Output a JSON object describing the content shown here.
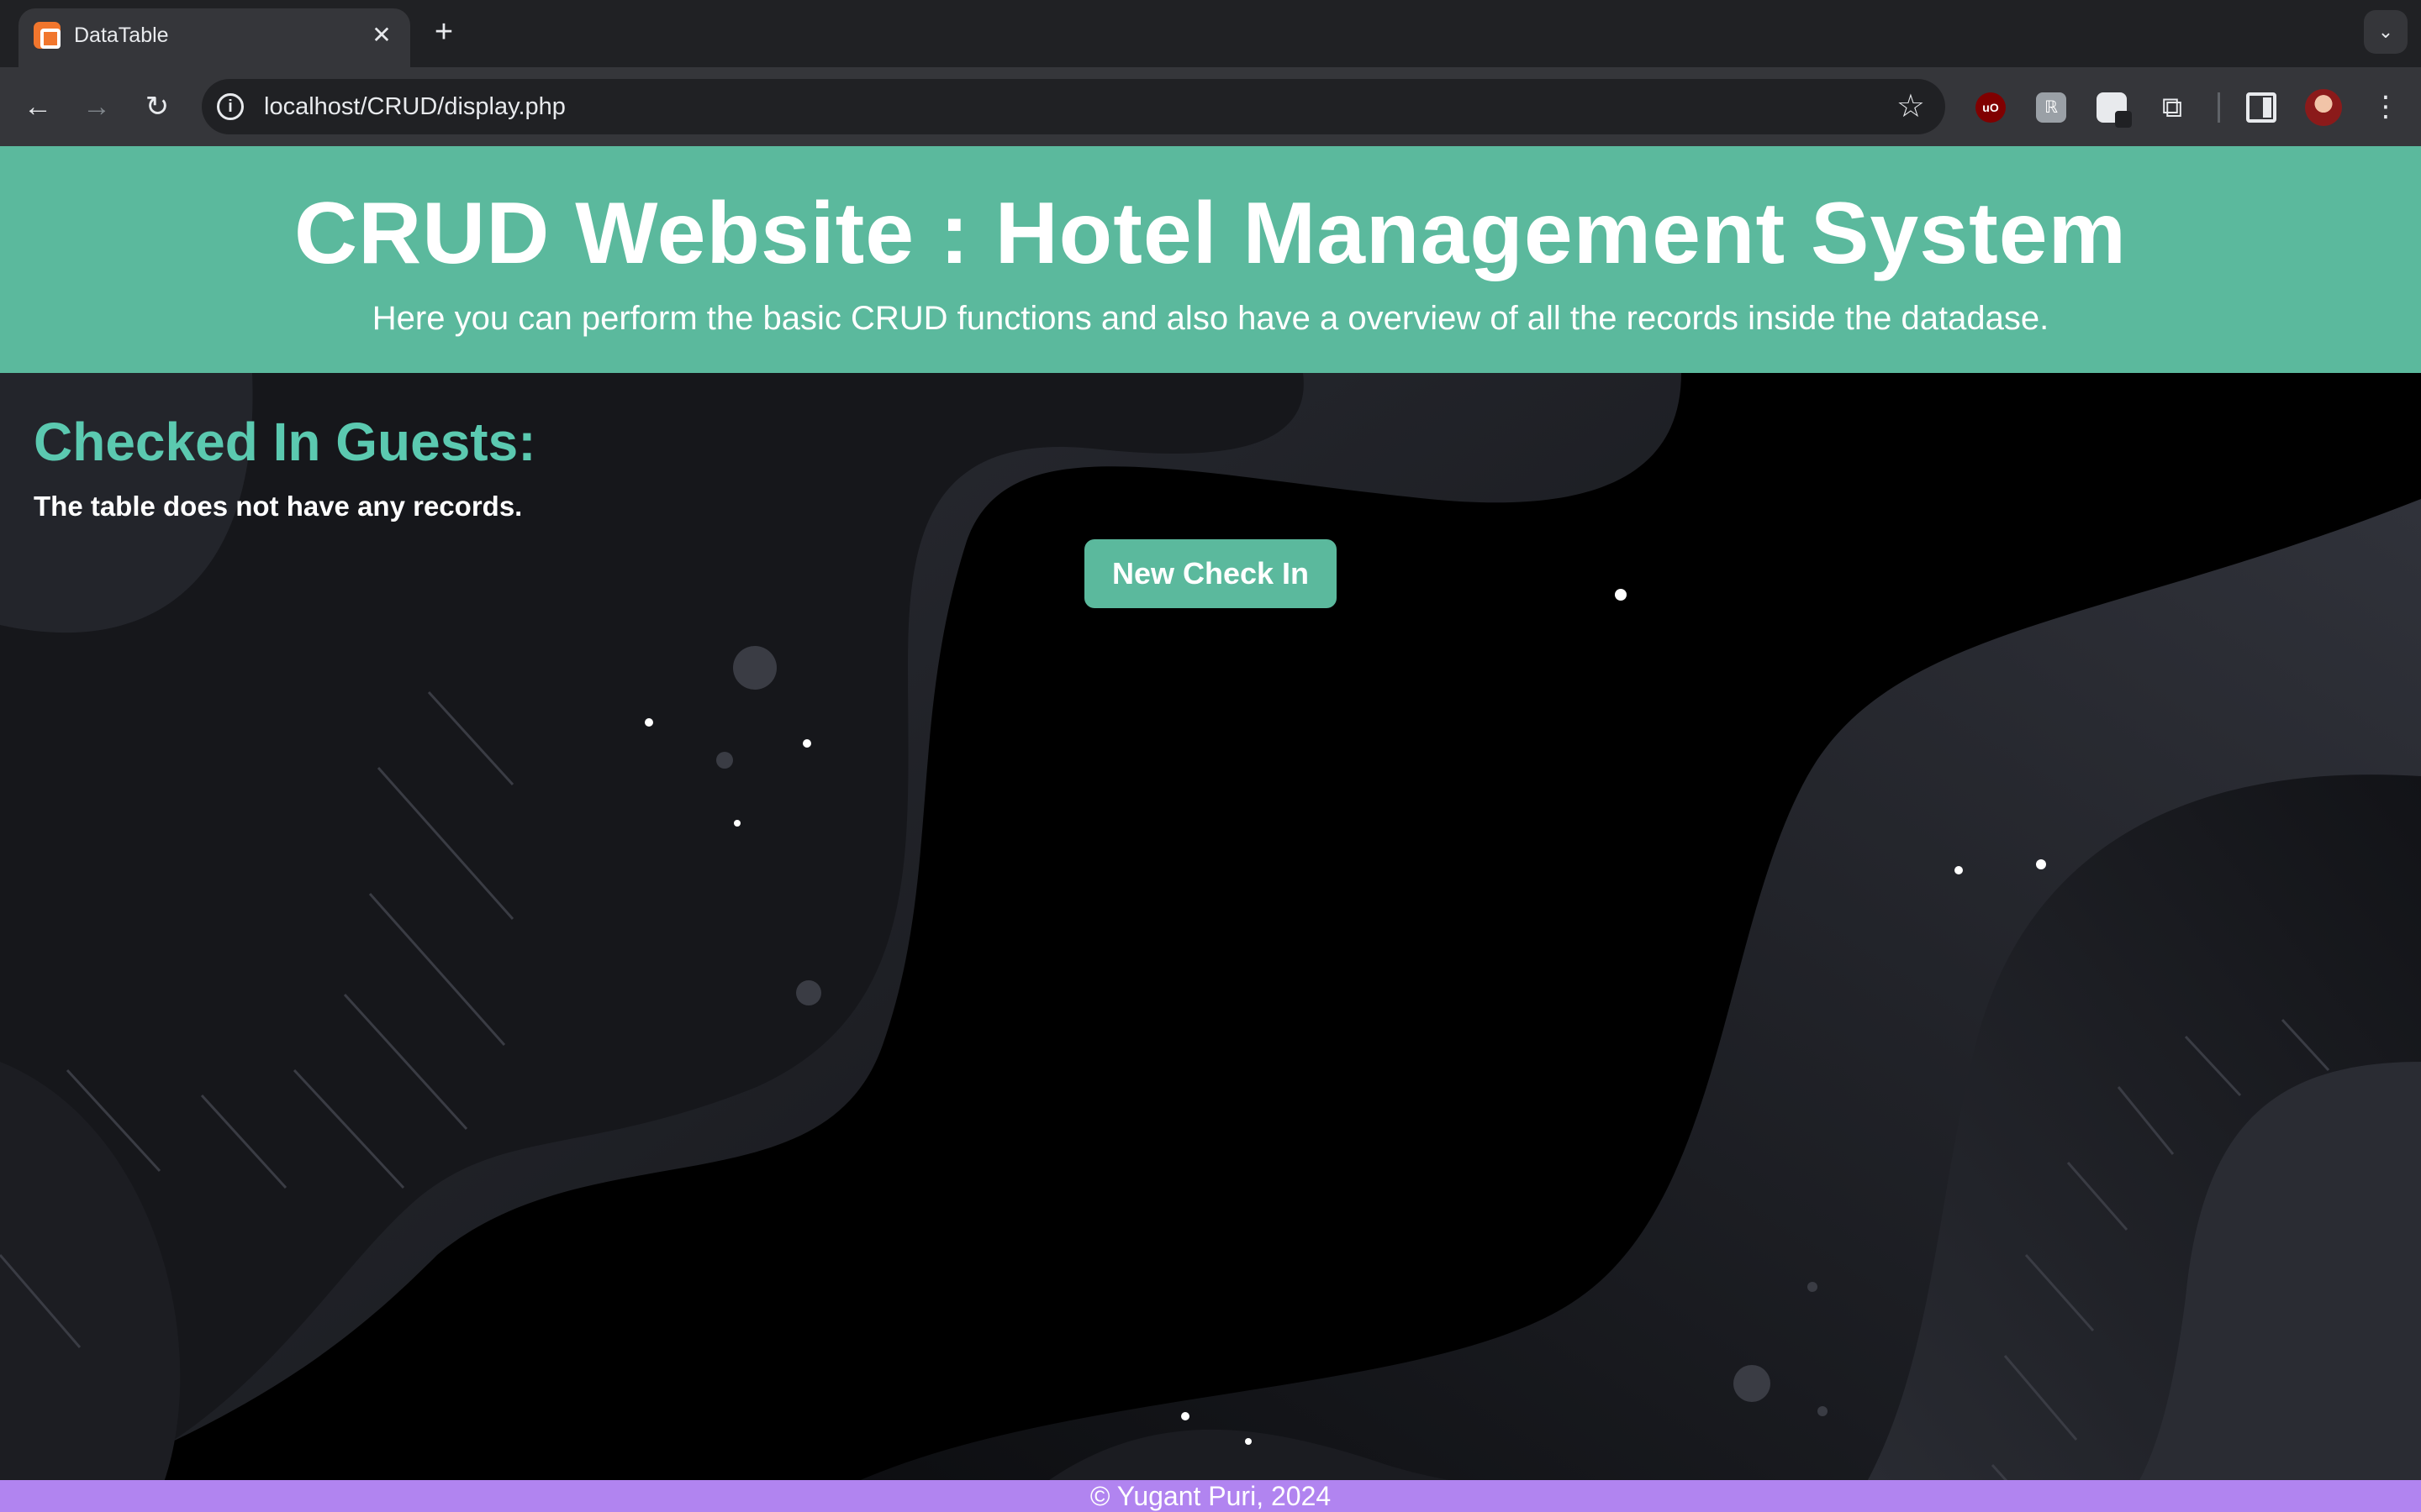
{
  "browser": {
    "tab_title": "DataTable",
    "tab_close": "✕",
    "new_tab": "+",
    "tab_search": "⌄",
    "url": "localhost/CRUD/display.php",
    "nav": {
      "back": "←",
      "forward": "→",
      "reload": "↻"
    },
    "info_icon": "i",
    "star": "☆",
    "ext_ublock": "uO",
    "ext_grey": "ℝ",
    "puzzle": "⧉",
    "menu": "⋮"
  },
  "header": {
    "title": "CRUD Website : Hotel Management System",
    "subtitle": "Here you can perform the basic CRUD functions and also have a overview of all the records inside the datadase."
  },
  "main": {
    "section_title": "Checked In Guests:",
    "empty_message": "The table does not have any records.",
    "new_button": "New Check In"
  },
  "footer": {
    "text": "© Yugant Puri, 2024"
  },
  "colors": {
    "header_bg": "#5bb99d",
    "section_title": "#5bc9b0",
    "footer_bg": "#b184f0",
    "page_bg": "#000000"
  }
}
